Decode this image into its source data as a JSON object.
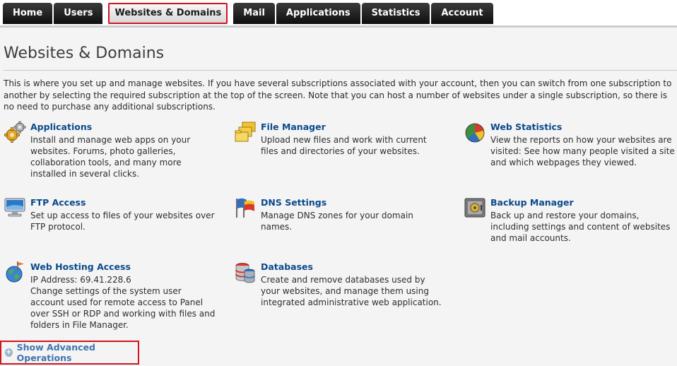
{
  "nav": {
    "tabs": [
      {
        "label": "Home"
      },
      {
        "label": "Users"
      },
      {
        "label": "Websites & Domains",
        "active": true
      },
      {
        "label": "Mail"
      },
      {
        "label": "Applications"
      },
      {
        "label": "Statistics"
      },
      {
        "label": "Account"
      }
    ]
  },
  "page": {
    "title": "Websites & Domains",
    "intro": "This is where you set up and manage websites. If you have several subscriptions associated with your account, then you can switch from one subscription to another by selecting the required subscription at the top of the screen. Note that you can host a number of websites under a single subscription, so there is no need to purchase any additional subscriptions."
  },
  "tools": [
    {
      "title": "Applications",
      "icon": "gears-icon",
      "description": "Install and manage web apps on your websites. Forums, photo galleries, collaboration tools, and many more installed in several clicks."
    },
    {
      "title": "File Manager",
      "icon": "folders-icon",
      "description": "Upload new files and work with current files and directories of your websites."
    },
    {
      "title": "Web Statistics",
      "icon": "pie-chart-icon",
      "description": "View the reports on how your websites are visited: See how many people visited a site and which webpages they viewed."
    },
    {
      "title": "FTP Access",
      "icon": "monitor-icon",
      "description": "Set up access to files of your websites over FTP protocol."
    },
    {
      "title": "DNS Settings",
      "icon": "flags-icon",
      "description": "Manage DNS zones for your domain names."
    },
    {
      "title": "Backup Manager",
      "icon": "safe-icon",
      "description": "Back up and restore your domains, including settings and content of websites and mail accounts."
    },
    {
      "title": "Web Hosting Access",
      "icon": "globe-flag-icon",
      "ip_line": "IP Address: 69.41.228.6",
      "description": "Change settings of the system user account used for remote access to Panel over SSH or RDP and working with files and folders in File Manager."
    },
    {
      "title": "Databases",
      "icon": "database-icon",
      "description": "Create and remove databases used by your websites, and manage them using integrated administrative web application."
    }
  ],
  "advanced": {
    "label": "Show Advanced Operations",
    "icon": "plus-circle-icon"
  },
  "colors": {
    "link": "#0b4a8a",
    "highlight_border": "#d4141c",
    "tab_dark": "#1a1a1a"
  }
}
